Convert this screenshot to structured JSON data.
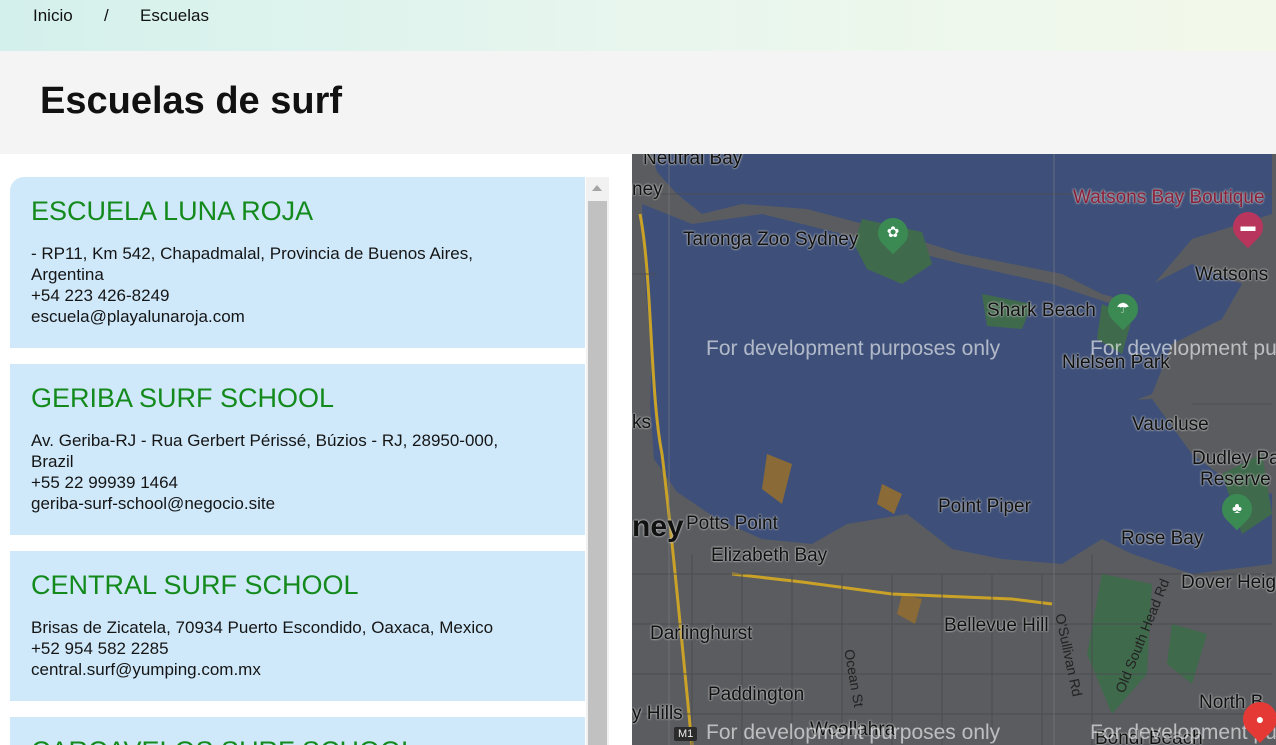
{
  "breadcrumb": {
    "home": "Inicio",
    "separator": "/",
    "current": "Escuelas"
  },
  "page": {
    "title": "Escuelas de surf"
  },
  "schools": [
    {
      "name": "ESCUELA LUNA ROJA",
      "address_line1": "- RP11, Km 542, Chapadmalal, Provincia de Buenos Aires,",
      "address_line2": "Argentina",
      "phone": "+54 223 426-8249",
      "email": "escuela@playalunaroja.com"
    },
    {
      "name": "GERIBA SURF SCHOOL",
      "address_line1": "Av. Geriba-RJ - Rua Gerbert Périssé, Búzios - RJ, 28950-000,",
      "address_line2": "Brazil",
      "phone": "+55 22 99939 1464",
      "email": "geriba-surf-school@negocio.site"
    },
    {
      "name": "CENTRAL SURF SCHOOL",
      "address_line1": "Brisas de Zicatela, 70934 Puerto Escondido, Oaxaca, Mexico",
      "address_line2": "",
      "phone": "+52 954 582 2285",
      "email": "central.surf@yumping.com.mx"
    },
    {
      "name": "CARCAVELOS SURF SCHOOL",
      "address_line1": "",
      "address_line2": "",
      "phone": "",
      "email": ""
    }
  ],
  "map": {
    "watermark": "For development purposes only",
    "labels": {
      "neutral_bay": "Neutral Bay",
      "sydney_partial_top": "ney",
      "taronga": "Taronga Zoo Sydney",
      "watsons_boutique": "Watsons Bay Boutique",
      "watsons": "Watsons",
      "shark_beach": "Shark Beach",
      "nielsen_park": "Nielsen Park",
      "vaucluse": "Vaucluse",
      "dudley_page": "Dudley Pag",
      "reserve": "Reserve",
      "ks": "ks",
      "sydney_partial": "ney",
      "potts_point": "Potts Point",
      "point_piper": "Point Piper",
      "elizabeth_bay": "Elizabeth Bay",
      "rose_bay": "Rose Bay",
      "dover_heights": "Dover Heigh",
      "darlinghurst": "Darlinghurst",
      "bellevue_hill": "Bellevue Hill",
      "paddington": "Paddington",
      "north_bondi": "North B",
      "woollahra": "Woollahra",
      "bondi_beach": "Bondi Beach",
      "hills": "y Hills",
      "ocean_st": "Ocean St",
      "osullivan_rd": "O'Sullivan Rd",
      "old_south_head": "Old South Head Rd",
      "m1": "M1"
    },
    "colors": {
      "water": "#3e5079",
      "land": "#5a5c60",
      "park": "#406a4c",
      "marker": "#e53935"
    },
    "icons": {
      "zoo": "paw-icon",
      "hotel": "bed-icon",
      "beach": "beach-icon",
      "park": "tree-icon",
      "marker": "map-pin-icon"
    }
  }
}
